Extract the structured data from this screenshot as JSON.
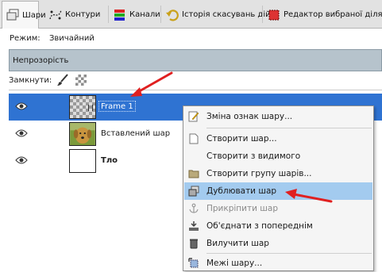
{
  "tabs": [
    {
      "label": "Шари",
      "icon": "layers-icon",
      "active": true
    },
    {
      "label": "Контури",
      "icon": "paths-icon",
      "active": false
    },
    {
      "label": "Канали",
      "icon": "channels-icon",
      "active": false
    },
    {
      "label": "Історія скасувань дій",
      "icon": "undo-history-icon",
      "active": false
    },
    {
      "label": "Редактор вибраної ділянки",
      "icon": "selection-editor-icon",
      "active": false
    }
  ],
  "mode": {
    "label": "Режим:",
    "value": "Звичайний"
  },
  "opacity": {
    "label": "Непрозорість"
  },
  "lock": {
    "label": "Замкнути:"
  },
  "layers": [
    {
      "name": "Frame 1",
      "selected": true,
      "visible": true
    },
    {
      "name": "Вставлений шар",
      "selected": false,
      "visible": true
    },
    {
      "name": "Тло",
      "selected": false,
      "visible": true
    }
  ],
  "context_menu": {
    "items": [
      {
        "label": "Зміна ознак шару...",
        "icon": "edit-attributes-icon",
        "disabled": false,
        "highlighted": false
      },
      {
        "label": "Створити шар...",
        "icon": "new-layer-icon",
        "disabled": false,
        "highlighted": false
      },
      {
        "label": "Створити з видимого",
        "icon": "",
        "disabled": false,
        "highlighted": false
      },
      {
        "label": "Створити групу шарів...",
        "icon": "folder-icon",
        "disabled": false,
        "highlighted": false
      },
      {
        "label": "Дублювати шар",
        "icon": "duplicate-icon",
        "disabled": false,
        "highlighted": true
      },
      {
        "label": "Прикріпити шар",
        "icon": "anchor-icon",
        "disabled": true,
        "highlighted": false
      },
      {
        "label": "Об'єднати з попереднім",
        "icon": "merge-down-icon",
        "disabled": false,
        "highlighted": false
      },
      {
        "label": "Вилучити шар",
        "icon": "trash-icon",
        "disabled": false,
        "highlighted": false
      },
      {
        "label": "Межі шару...",
        "icon": "layer-boundary-icon",
        "disabled": false,
        "highlighted": false
      }
    ]
  },
  "colors": {
    "selection": "#2f73d2",
    "menu_highlight": "#a3cbef",
    "annotation_arrow": "#e02020"
  }
}
